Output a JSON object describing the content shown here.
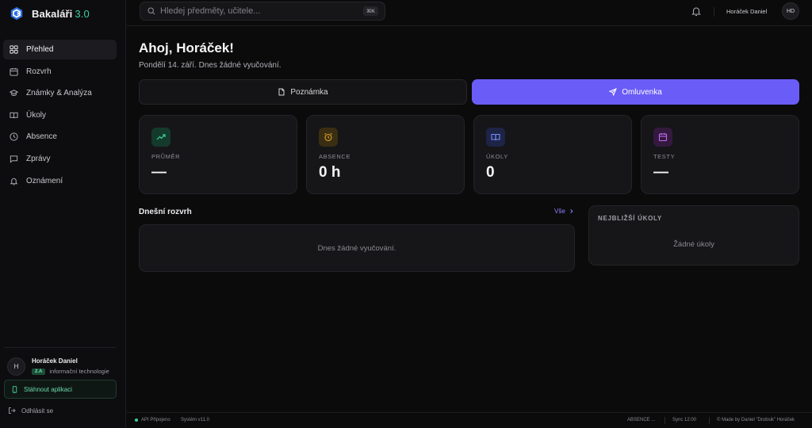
{
  "app": {
    "name": "Bakaláři",
    "version": "3.0",
    "accent": "#3ad19b",
    "brand_icon": "bakalari-logo-icon"
  },
  "sidebar": {
    "items": [
      {
        "label": "Přehled",
        "icon": "grid-icon",
        "active": true
      },
      {
        "label": "Rozvrh",
        "icon": "calendar-icon",
        "active": false
      },
      {
        "label": "Známky & Analýza",
        "icon": "graduation-cap-icon",
        "active": false
      },
      {
        "label": "Úkoly",
        "icon": "book-open-icon",
        "active": false
      },
      {
        "label": "Absence",
        "icon": "clock-icon",
        "active": false
      },
      {
        "label": "Zprávy",
        "icon": "message-icon",
        "active": false
      },
      {
        "label": "Oznámení",
        "icon": "bell-icon",
        "active": false
      }
    ],
    "profile": {
      "initial": "H",
      "name": "Horáček Daniel",
      "class": "2.A",
      "program": "informační technologie"
    },
    "download_label": "Stáhnout aplikaci",
    "logout_label": "Odhlásit se"
  },
  "topbar": {
    "search_placeholder": "Hledej předměty, učitele...",
    "shortcut": "⌘K",
    "user_name": "Horáček Daniel",
    "user_initials": "HD"
  },
  "main": {
    "greeting": "Ahoj, Horáček!",
    "subtitle": "Pondělí 14. září. Dnes žádné vyučování.",
    "note_button": "Poznámka",
    "excuse_button": "Omluvenka",
    "excuse_color": "#6a5cf6",
    "stats": [
      {
        "label": "PRŮMĚR",
        "value": "—",
        "icon": "trending-up-icon",
        "color": "#3ad19b"
      },
      {
        "label": "ABSENCE",
        "value": "0 h",
        "icon": "alarm-clock-icon",
        "color": "#e0a326"
      },
      {
        "label": "ÚKOLY",
        "value": "0",
        "icon": "book-open-icon",
        "color": "#7b8cff"
      },
      {
        "label": "TESTY",
        "value": "—",
        "icon": "calendar-icon",
        "color": "#c06cf0"
      }
    ],
    "schedule": {
      "title": "Dnešní rozvrh",
      "all_link": "Vše",
      "empty": "Dnes žádné vyučování."
    },
    "tasks": {
      "title": "NEJBLIŽŠÍ ÚKOLY",
      "empty": "Žádné úkoly"
    }
  },
  "footer": {
    "api_status": "API Připojeno",
    "system": "Systém v11.0",
    "right1": "ABSENCE ...",
    "sync": "Sync 12:00",
    "made_by": "© Made by Daniel \"Drobsik\" Horáček"
  }
}
